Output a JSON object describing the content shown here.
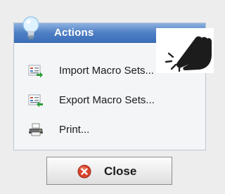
{
  "panel": {
    "title": "Actions",
    "icon": "lightbulb-icon",
    "items": [
      {
        "label": "Import Macro Sets...",
        "icon": "import-icon"
      },
      {
        "label": "Export Macro Sets...",
        "icon": "export-icon"
      },
      {
        "label": "Print...",
        "icon": "printer-icon"
      }
    ]
  },
  "close_button": {
    "label": "Close",
    "icon": "close-icon"
  },
  "overlay": {
    "icon": "pointing-hand-icon"
  },
  "colors": {
    "header_blue": "#4f7fc4",
    "close_red": "#d8432c"
  }
}
